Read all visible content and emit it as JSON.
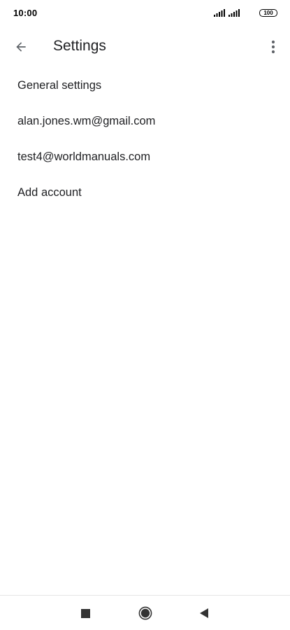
{
  "status_bar": {
    "time": "10:00",
    "battery_level": "100",
    "icons": [
      "signal-icon",
      "signal-icon",
      "battery-icon"
    ]
  },
  "app_bar": {
    "title": "Settings",
    "back_icon": "arrow-back-icon",
    "overflow_icon": "more-vert-icon"
  },
  "settings_list": {
    "items": [
      {
        "label": "General settings"
      },
      {
        "label": "alan.jones.wm@gmail.com"
      },
      {
        "label": "test4@worldmanuals.com"
      },
      {
        "label": "Add account"
      }
    ]
  },
  "nav_bar": {
    "buttons": [
      "recent-apps-icon",
      "home-icon",
      "back-triangle-icon"
    ]
  },
  "colors": {
    "background": "#ffffff",
    "text_primary": "#202124",
    "icon": "#5f6368",
    "nav_icon": "#333333"
  }
}
